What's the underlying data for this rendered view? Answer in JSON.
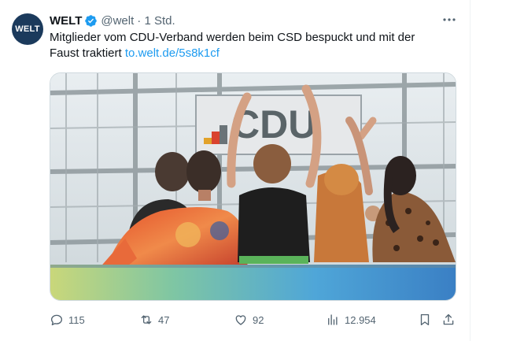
{
  "tweet": {
    "author": {
      "avatar_text": "WELT",
      "name": "WELT",
      "verified_icon": "verified-badge-icon",
      "handle": "@welt",
      "time": "· 1 Std."
    },
    "more_icon": "more-icon",
    "text": "Mitglieder vom CDU-Verband werden beim CSD bespuckt und mit der Faust traktiert ",
    "link": "to.welt.de/5s8k1cf",
    "media": {
      "sign_text": "CDU"
    },
    "actions": {
      "reply": {
        "icon": "reply-icon",
        "count": "115"
      },
      "retweet": {
        "icon": "retweet-icon",
        "count": "47"
      },
      "like": {
        "icon": "like-icon",
        "count": "92"
      },
      "views": {
        "icon": "views-icon",
        "count": "12.954"
      },
      "bookmark": {
        "icon": "bookmark-icon"
      },
      "share": {
        "icon": "share-icon"
      }
    }
  },
  "colors": {
    "accent": "#1d9bf0",
    "muted": "#536471",
    "avatar_bg": "#1b3a5c"
  }
}
